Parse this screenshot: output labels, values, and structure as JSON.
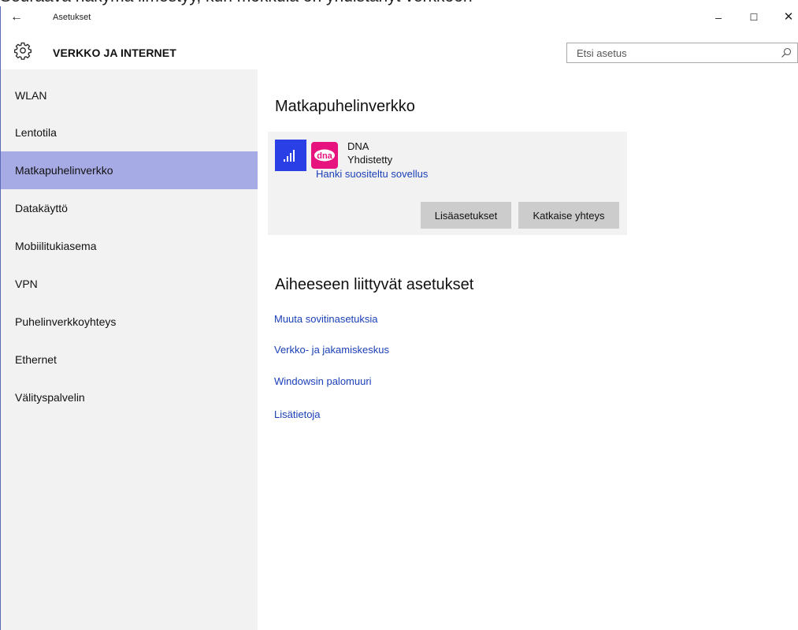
{
  "caption": "Seuraava näkymä ilmestyy, kun mokkula on yhdistänyt verkkoon",
  "window": {
    "title": "Asetukset",
    "controls": {
      "minimize": "–",
      "maximize": "☐",
      "close": "✕"
    }
  },
  "header": {
    "title": "VERKKO JA INTERNET",
    "icon": "gear-icon",
    "search_placeholder": "Etsi asetus"
  },
  "sidebar": {
    "selected_index": 2,
    "items": [
      {
        "label": "WLAN"
      },
      {
        "label": "Lentotila"
      },
      {
        "label": "Matkapuhelinverkko"
      },
      {
        "label": "Datakäyttö"
      },
      {
        "label": "Mobiilitukiasema"
      },
      {
        "label": "VPN"
      },
      {
        "label": "Puhelinverkkoyhteys"
      },
      {
        "label": "Ethernet"
      },
      {
        "label": "Välityspalvelin"
      }
    ]
  },
  "main": {
    "heading": "Matkapuhelinverkko",
    "network": {
      "carrier": "DNA",
      "logo_text": "dna",
      "status": "Yhdistetty",
      "app_link": "Hanki suositeltu sovellus",
      "advanced_button": "Lisäasetukset",
      "disconnect_button": "Katkaise yhteys"
    },
    "related_heading": "Aiheeseen liittyvät asetukset",
    "related_links": [
      {
        "label": "Muuta sovitinasetuksia"
      },
      {
        "label": "Verkko- ja jakamiskeskus"
      },
      {
        "label": "Windowsin palomuuri"
      },
      {
        "label": "Lisätietoja"
      }
    ]
  },
  "colors": {
    "accent": "#2b3fe6",
    "selected": "#a7abe5",
    "link": "#1a3fb8",
    "carrier_brand": "#e6137e"
  }
}
